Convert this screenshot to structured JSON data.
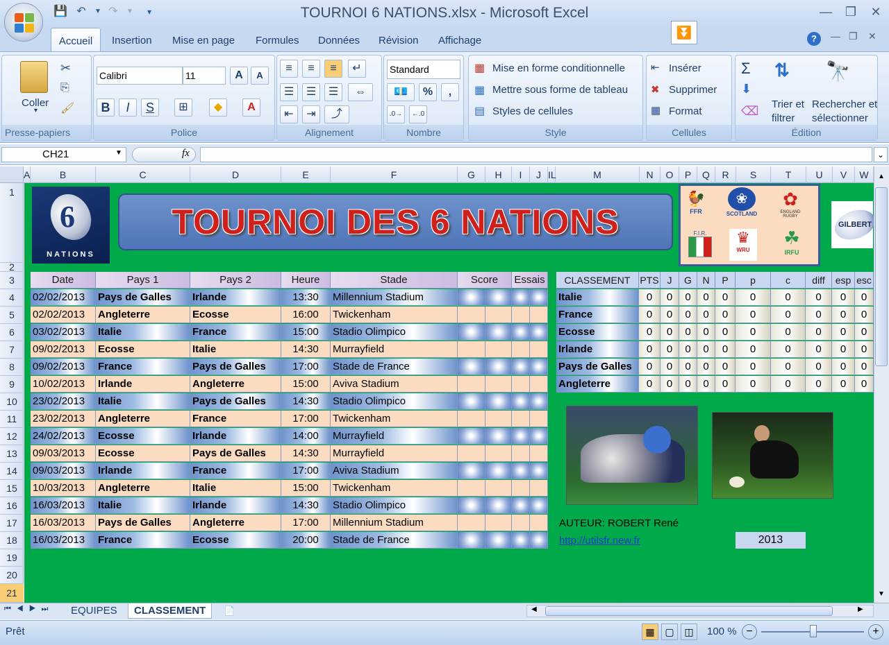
{
  "window": {
    "title": "TOURNOI 6 NATIONS.xlsx - Microsoft Excel"
  },
  "ribbon": {
    "tabs": [
      "Accueil",
      "Insertion",
      "Mise en page",
      "Formules",
      "Données",
      "Révision",
      "Affichage"
    ],
    "clipboard": {
      "paste": "Coller",
      "label": "Presse-papiers"
    },
    "font": {
      "name": "Calibri",
      "size": "11",
      "label": "Police",
      "bold": "B",
      "italic": "I",
      "underline": "S"
    },
    "alignment": {
      "label": "Alignement"
    },
    "number": {
      "format": "Standard",
      "label": "Nombre",
      "percent": "%",
      "thousands": ","
    },
    "style": {
      "conditional": "Mise en forme conditionnelle",
      "table": "Mettre sous forme de tableau",
      "cell_styles": "Styles de cellules",
      "label": "Style"
    },
    "cells": {
      "insert": "Insérer",
      "delete": "Supprimer",
      "format": "Format",
      "label": "Cellules"
    },
    "editing": {
      "sort": "Trier et",
      "sort2": "filtrer",
      "find": "Rechercher et",
      "find2": "sélectionner",
      "label": "Édition"
    }
  },
  "formula_bar": {
    "name_box": "CH21",
    "fx": "fx",
    "content": ""
  },
  "columns": [
    "A",
    "B",
    "C",
    "D",
    "E",
    "F",
    "G",
    "H",
    "I",
    "J",
    "IL",
    "M",
    "N",
    "O",
    "P",
    "Q",
    "R",
    "S",
    "T",
    "U",
    "V",
    "W"
  ],
  "rows": [
    "1",
    "2",
    "3",
    "4",
    "5",
    "6",
    "7",
    "8",
    "9",
    "10",
    "11",
    "12",
    "13",
    "14",
    "15",
    "16",
    "17",
    "18",
    "19",
    "20",
    "21"
  ],
  "banner": {
    "title": "TOURNOI DES 6 NATIONS",
    "logo_text": "NATIONS"
  },
  "emblems": {
    "ffr": "FFR",
    "scotland": "SCOTLAND",
    "england": "ENGLAND RUGBY",
    "fir": "F.I.R.",
    "wru": "WRU",
    "irfu": "IRFU",
    "ball": "GILBERT"
  },
  "fixtures": {
    "headers": [
      "Date",
      "Pays 1",
      "Pays 2",
      "Heure",
      "Stade",
      "Score",
      "Essais"
    ],
    "rows": [
      [
        "02/02/2013",
        "Pays de Galles",
        "Irlande",
        "13:30",
        "Millennium Stadium"
      ],
      [
        "02/02/2013",
        "Angleterre",
        "Ecosse",
        "16:00",
        "Twickenham"
      ],
      [
        "03/02/2013",
        "Italie",
        "France",
        "15:00",
        "Stadio Olimpico"
      ],
      [
        "09/02/2013",
        "Ecosse",
        "Italie",
        "14:30",
        "Murrayfield"
      ],
      [
        "09/02/2013",
        "France",
        "Pays de Galles",
        "17:00",
        "Stade de France"
      ],
      [
        "10/02/2013",
        "Irlande",
        "Angleterre",
        "15:00",
        "Aviva Stadium"
      ],
      [
        "23/02/2013",
        "Italie",
        "Pays de Galles",
        "14:30",
        "Stadio Olimpico"
      ],
      [
        "23/02/2013",
        "Angleterre",
        "France",
        "17:00",
        "Twickenham"
      ],
      [
        "24/02/2013",
        "Ecosse",
        "Irlande",
        "14:00",
        "Murrayfield"
      ],
      [
        "09/03/2013",
        "Ecosse",
        "Pays de Galles",
        "14:30",
        "Murrayfield"
      ],
      [
        "09/03/2013",
        "Irlande",
        "France",
        "17:00",
        "Aviva Stadium"
      ],
      [
        "10/03/2013",
        "Angleterre",
        "Italie",
        "15:00",
        "Twickenham"
      ],
      [
        "16/03/2013",
        "Italie",
        "Irlande",
        "14:30",
        "Stadio Olimpico"
      ],
      [
        "16/03/2013",
        "Pays de Galles",
        "Angleterre",
        "17:00",
        "Millennium Stadium"
      ],
      [
        "16/03/2013",
        "France",
        "Ecosse",
        "20:00",
        "Stade de France"
      ]
    ]
  },
  "standings": {
    "headers": [
      "CLASSEMENT",
      "PTS",
      "J",
      "G",
      "N",
      "P",
      "p",
      "c",
      "diff",
      "esp",
      "esc"
    ],
    "rows": [
      [
        "Italie",
        "0",
        "0",
        "0",
        "0",
        "0",
        "0",
        "0",
        "0",
        "0",
        "0"
      ],
      [
        "France",
        "0",
        "0",
        "0",
        "0",
        "0",
        "0",
        "0",
        "0",
        "0",
        "0"
      ],
      [
        "Ecosse",
        "0",
        "0",
        "0",
        "0",
        "0",
        "0",
        "0",
        "0",
        "0",
        "0"
      ],
      [
        "Irlande",
        "0",
        "0",
        "0",
        "0",
        "0",
        "0",
        "0",
        "0",
        "0",
        "0"
      ],
      [
        "Pays de Galles",
        "0",
        "0",
        "0",
        "0",
        "0",
        "0",
        "0",
        "0",
        "0",
        "0"
      ],
      [
        "Angleterre",
        "0",
        "0",
        "0",
        "0",
        "0",
        "0",
        "0",
        "0",
        "0",
        "0"
      ]
    ]
  },
  "author": {
    "text": "AUTEUR: ROBERT René",
    "link": "http://utilsfr.new.fr",
    "year": "2013"
  },
  "sheet_tabs": [
    "EQUIPES",
    "CLASSEMENT"
  ],
  "status": {
    "ready": "Prêt",
    "zoom": "100 %"
  },
  "colors": {
    "sheet_bg": "#00a94a",
    "title_red": "#d0201c",
    "header_purple": "#cdbbe0",
    "peach": "#fbdcc0",
    "blue": "#6e93cc"
  }
}
